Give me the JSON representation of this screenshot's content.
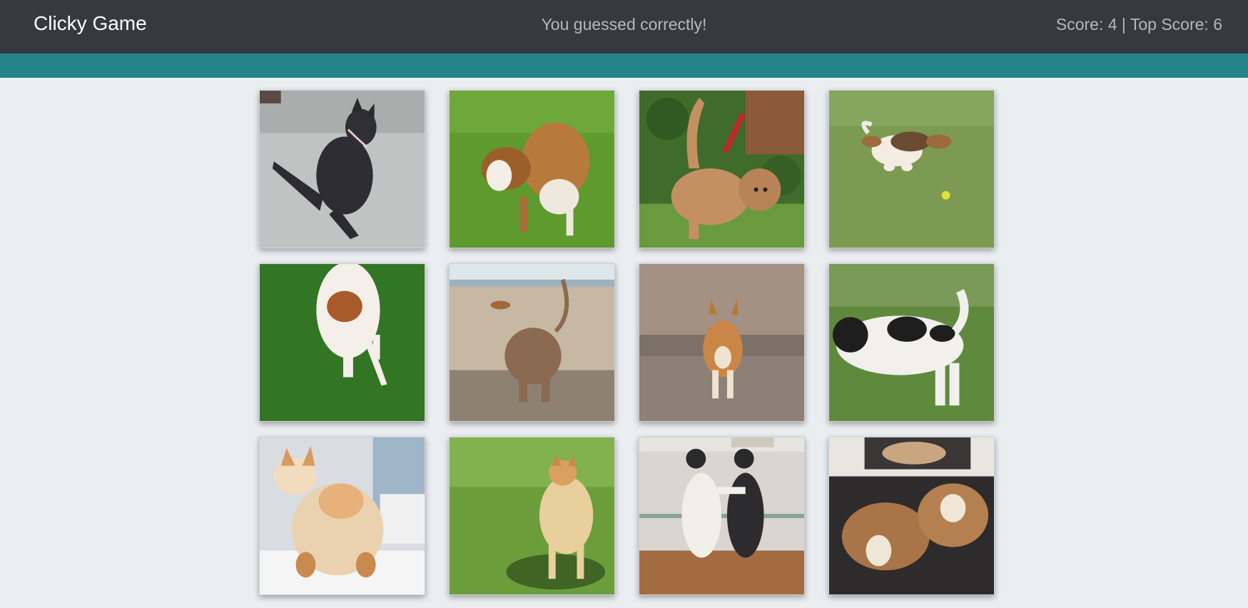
{
  "navbar": {
    "brand": "Clicky Game",
    "message": "You guessed correctly!",
    "score_text": "Score: 4 | Top Score: 6"
  },
  "colors": {
    "navbar_bg": "#343a40",
    "banner_bg": "#24848a",
    "page_bg": "#ebeef1"
  },
  "cards": [
    {
      "subject": "black french bulldog sitting splayed"
    },
    {
      "subject": "brown and white dog sniffing grass"
    },
    {
      "subject": "curly apricot doodle playing in garden"
    },
    {
      "subject": "beagle leaping toward tennis ball"
    },
    {
      "subject": "white and brown dog lying on grass"
    },
    {
      "subject": "dog digging hole on beach"
    },
    {
      "subject": "corgi walking away"
    },
    {
      "subject": "black and white dog on grass"
    },
    {
      "subject": "fluffy corgi rear on table"
    },
    {
      "subject": "shiba inu standing in grass"
    },
    {
      "subject": "two french bulldog puppies hugging"
    },
    {
      "subject": "two bulldogs lying on floor"
    }
  ]
}
